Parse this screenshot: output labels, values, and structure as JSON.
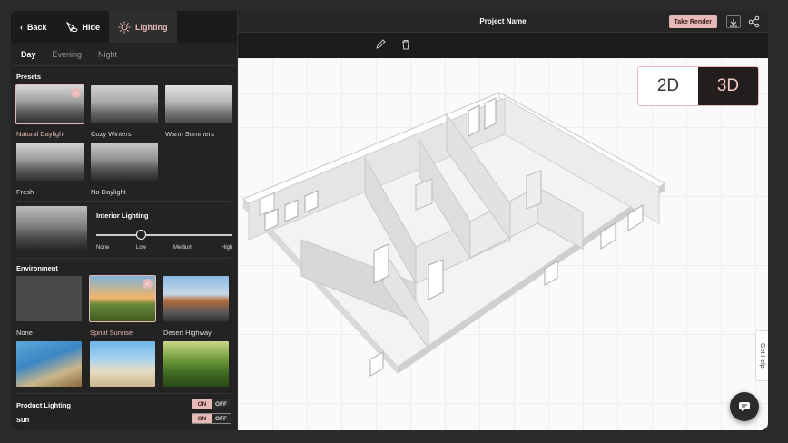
{
  "header": {
    "project_name": "Project Name",
    "take_render_label": "Take Render"
  },
  "sidebar": {
    "back_label": "Back",
    "hide_label": "Hide",
    "lighting_label": "Lighting",
    "time_tabs": [
      "Day",
      "Evening",
      "Night"
    ],
    "presets_title": "Presets",
    "presets": [
      "Natural Daylight",
      "Cozy Winters",
      "Warm Summers",
      "Fresh",
      "No Daylight"
    ],
    "interior_lighting_title": "Interior Lighting",
    "interior_levels": [
      "None",
      "Low",
      "Medium",
      "High"
    ],
    "interior_level_value": 0.33,
    "environment_title": "Environment",
    "environments": [
      "None",
      "Spruit Sunrise",
      "Desert Highway"
    ],
    "product_lighting_label": "Product Lighting",
    "sun_label": "Sun",
    "on_label": "ON",
    "off_label": "OFF"
  },
  "view_toggle": {
    "option_2d": "2D",
    "option_3d": "3D",
    "selected": "3D"
  },
  "help_label": "Get Help",
  "colors": {
    "accent": "#e6b9b6",
    "dark": "#232323"
  }
}
